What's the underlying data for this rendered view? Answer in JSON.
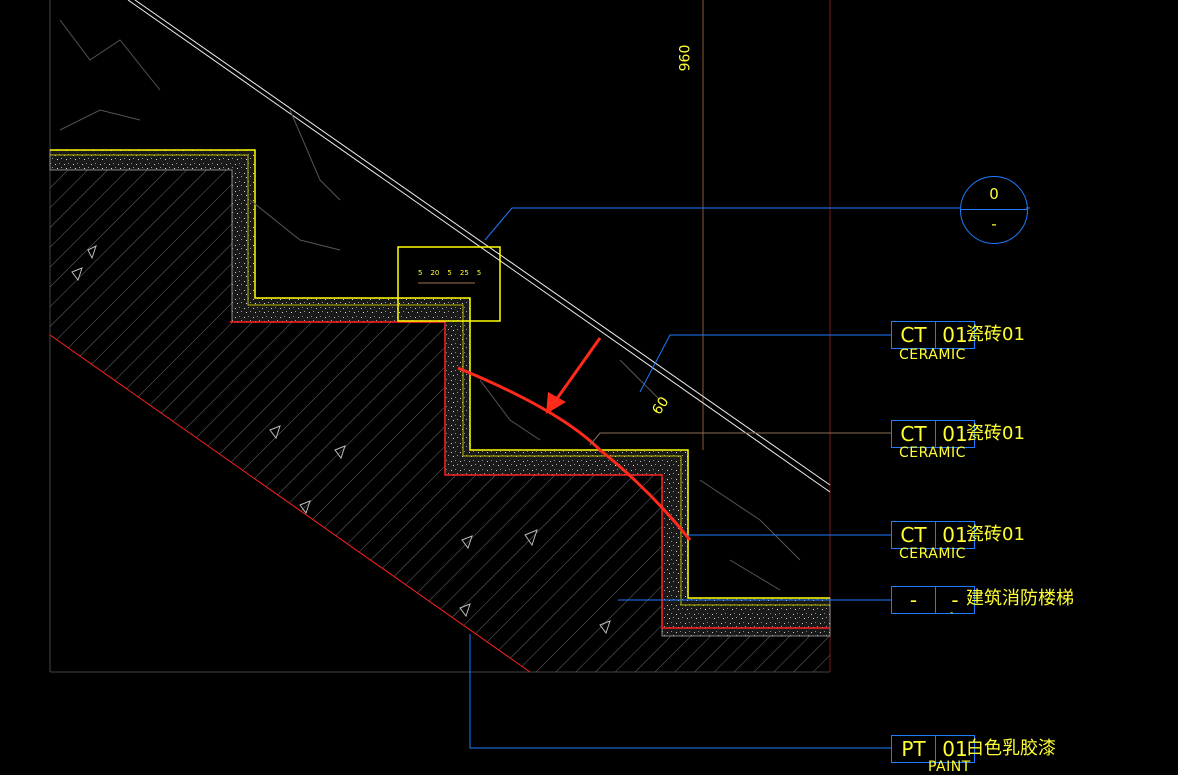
{
  "drawing": {
    "dimension_vertical": "960",
    "dimension_diag": "60",
    "detail_dims": [
      "5",
      "20",
      "5",
      "25",
      "5"
    ],
    "section_callout": {
      "top": "0",
      "bottom": "-"
    },
    "tags": [
      {
        "code": "CT",
        "num": "01",
        "sub": "CERAMIC",
        "name": "瓷砖01"
      },
      {
        "code": "CT",
        "num": "01",
        "sub": "CERAMIC",
        "name": "瓷砖01"
      },
      {
        "code": "CT",
        "num": "01",
        "sub": "CERAMIC",
        "name": "瓷砖01"
      },
      {
        "code": "-",
        "num": "-",
        "sub": "-",
        "name": "建筑消防楼梯"
      },
      {
        "code": "PT",
        "num": "01",
        "sub": "PAINT",
        "name": "白色乳胶漆"
      }
    ],
    "colors": {
      "background": "#000000",
      "leader": "#1e7bff",
      "text": "#ffff33",
      "finish": "#ffff00",
      "boundary": "#ff2020",
      "annotation": "#ff2a1a"
    }
  }
}
